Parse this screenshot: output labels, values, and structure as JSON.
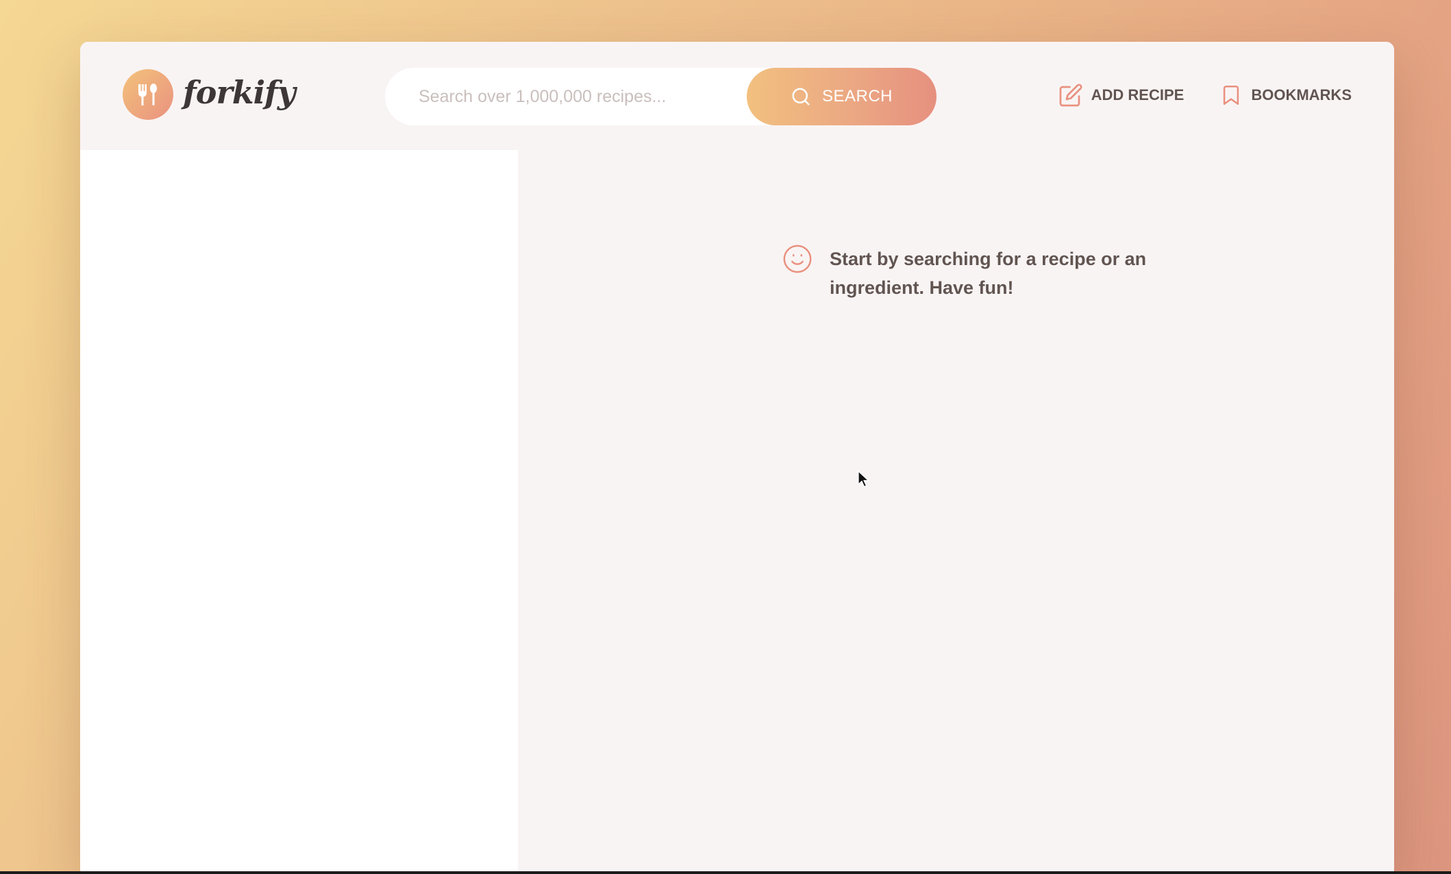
{
  "app": {
    "name": "forkify"
  },
  "header": {
    "logo_text": "forkify",
    "logo_icon": "fork-spoon-icon",
    "search": {
      "placeholder": "Search over 1,000,000 recipes...",
      "value": "",
      "button_label": "SEARCH",
      "button_icon": "search-icon"
    },
    "nav": {
      "add_recipe_label": "ADD RECIPE",
      "add_recipe_icon": "edit-icon",
      "bookmarks_label": "BOOKMARKS",
      "bookmarks_icon": "bookmark-icon"
    }
  },
  "main": {
    "message": "Start by searching for a recipe or an ingredient. Have fun!",
    "message_icon": "smile-icon"
  },
  "colors": {
    "accent": "#e9917f",
    "accent_light": "#f2c07f",
    "text": "#615551",
    "panel_bg": "#f9f4f4",
    "sidebar_bg": "#ffffff"
  }
}
